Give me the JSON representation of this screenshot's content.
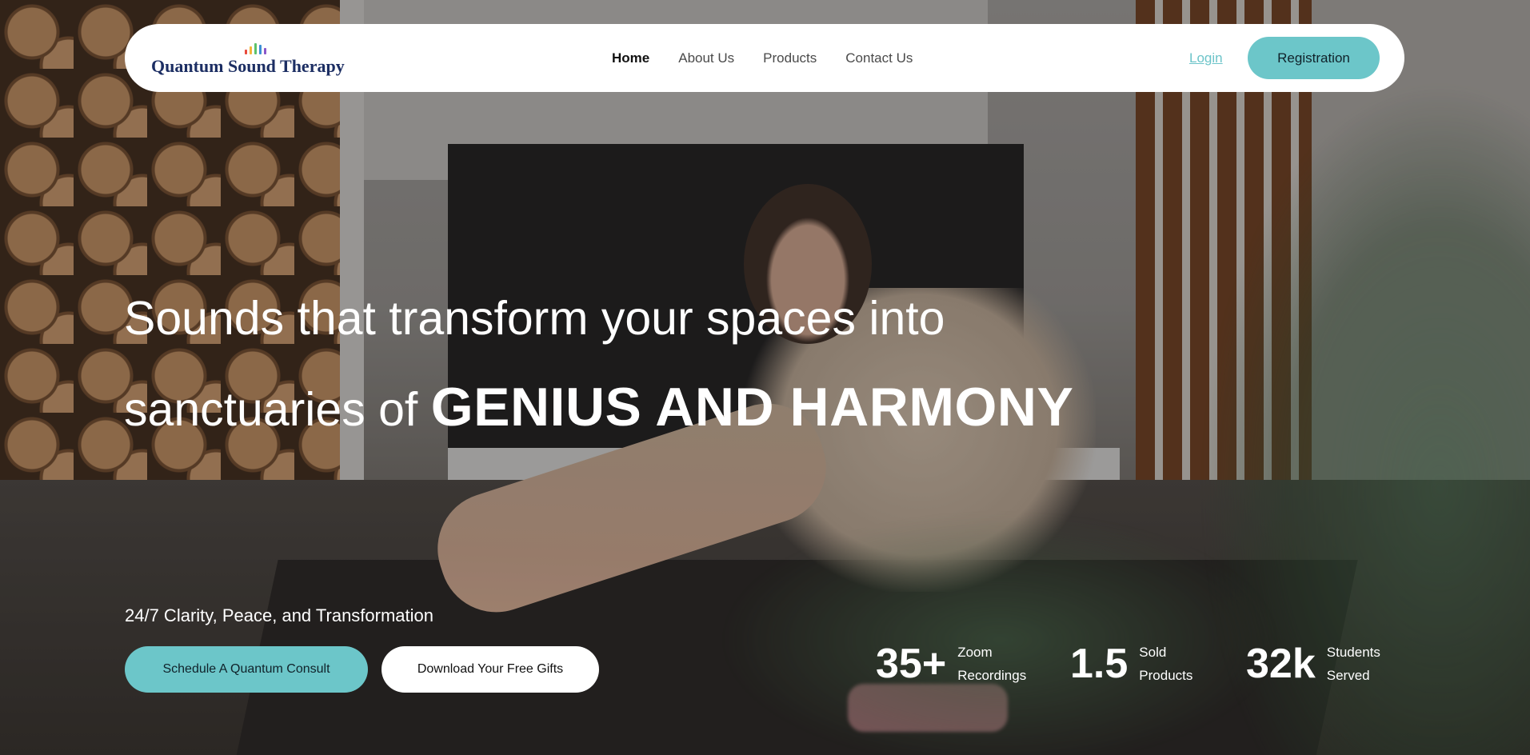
{
  "logo": {
    "text": "Quantum Sound Therapy",
    "bar_colors": [
      "#e84a3c",
      "#f4b63a",
      "#5dc26a",
      "#3d8fd6",
      "#8a57c9"
    ],
    "bar_heights": [
      6,
      10,
      14,
      12,
      8
    ]
  },
  "nav": {
    "items": [
      {
        "label": "Home",
        "active": true
      },
      {
        "label": "About Us",
        "active": false
      },
      {
        "label": "Products",
        "active": false
      },
      {
        "label": "Contact Us",
        "active": false
      }
    ],
    "login_label": "Login",
    "registration_label": "Registration"
  },
  "hero": {
    "line1": "Sounds that transform your spaces into",
    "line2_prefix": "sanctuaries of ",
    "line2_emphasis": "GENIUS AND HARMONY",
    "tagline": "24/7 Clarity, Peace, and Transformation",
    "primary_cta": "Schedule A Quantum Consult",
    "secondary_cta": "Download Your Free Gifts"
  },
  "stats": [
    {
      "value": "35+",
      "label_line1": "Zoom",
      "label_line2": "Recordings"
    },
    {
      "value": "1.5",
      "label_line1": "Sold",
      "label_line2": "Products"
    },
    {
      "value": "32k",
      "label_line1": "Students",
      "label_line2": "Served"
    }
  ],
  "colors": {
    "accent": "#6cc6c9",
    "logo_text": "#1c2e63",
    "login_link": "#6cc4c9"
  }
}
